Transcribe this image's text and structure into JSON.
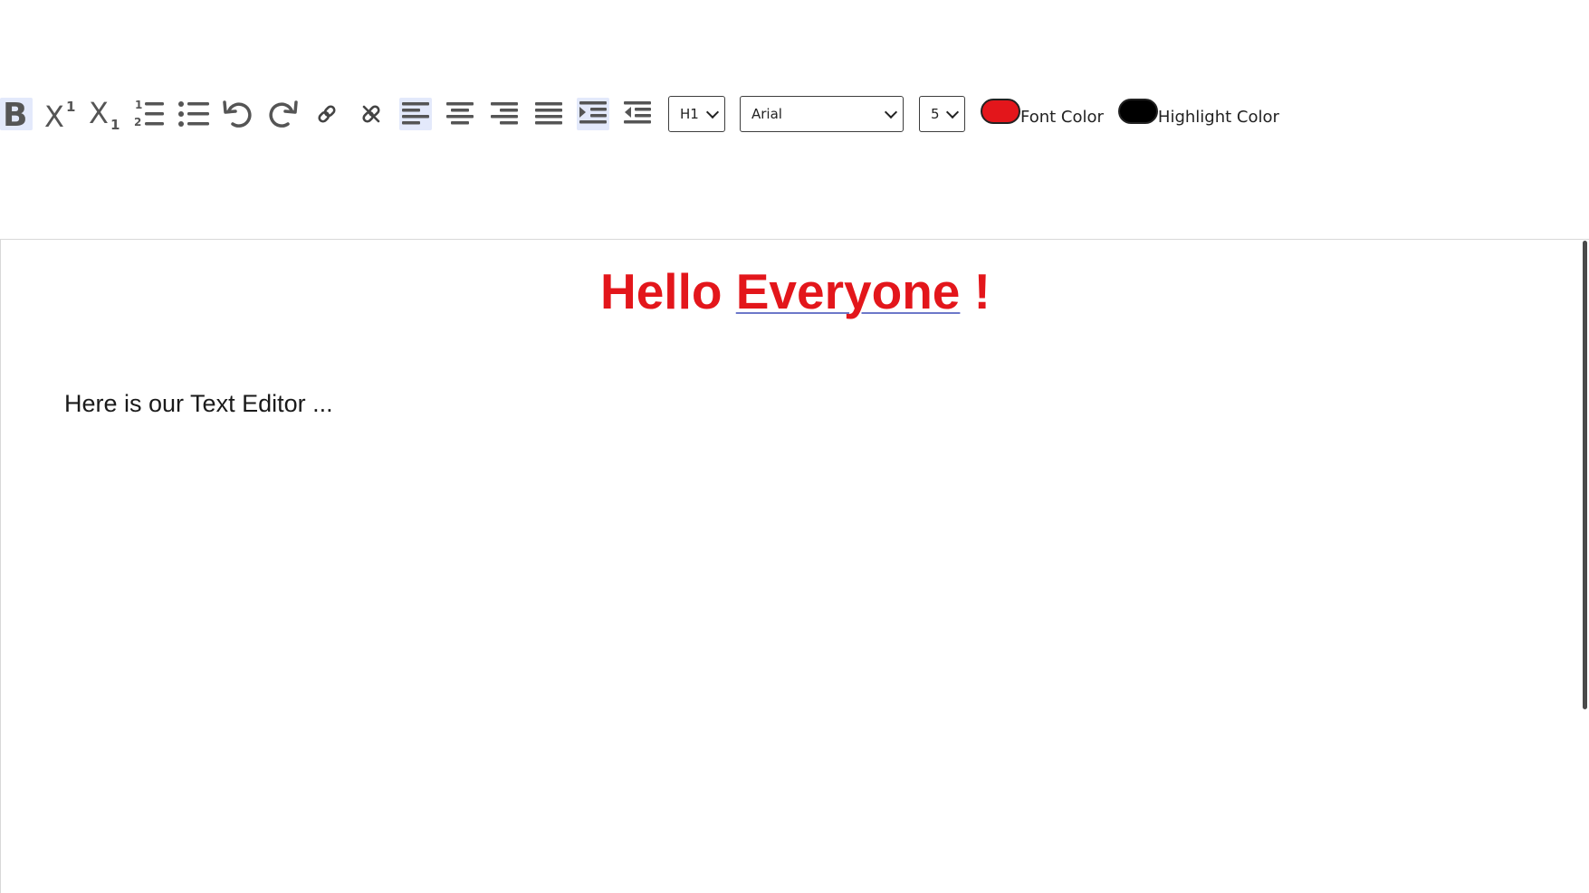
{
  "toolbar": {
    "buttons": [
      {
        "name": "bold-button",
        "icon": "bold-icon"
      },
      {
        "name": "superscript-button",
        "icon": "superscript-icon"
      },
      {
        "name": "subscript-button",
        "icon": "subscript-icon"
      },
      {
        "name": "ordered-list-button",
        "icon": "ordered-list-icon"
      },
      {
        "name": "unordered-list-button",
        "icon": "unordered-list-icon"
      },
      {
        "name": "undo-button",
        "icon": "undo-icon"
      },
      {
        "name": "redo-button",
        "icon": "redo-icon"
      },
      {
        "name": "link-button",
        "icon": "link-icon"
      },
      {
        "name": "unlink-button",
        "icon": "unlink-icon"
      },
      {
        "name": "align-left-button",
        "icon": "align-left-icon"
      },
      {
        "name": "align-center-button",
        "icon": "align-center-icon"
      },
      {
        "name": "align-right-button",
        "icon": "align-right-icon"
      },
      {
        "name": "justify-button",
        "icon": "justify-icon"
      },
      {
        "name": "indent-button",
        "icon": "indent-icon"
      },
      {
        "name": "outdent-button",
        "icon": "outdent-icon"
      }
    ],
    "active_buttons": [
      "bold-button",
      "align-left-button",
      "indent-button"
    ],
    "heading_select": {
      "value": "H1"
    },
    "font_select": {
      "value": "Arial"
    },
    "size_select": {
      "value": "5"
    },
    "font_color": {
      "label": "Font Color",
      "value": "#e3161b"
    },
    "highlight_color": {
      "label": "Highlight Color",
      "value": "#000000"
    }
  },
  "editor": {
    "heading": {
      "word1": "Hello",
      "word2": "Everyone",
      "tail": " !"
    },
    "paragraph": "Here is our Text Editor ..."
  },
  "colors": {
    "icon": "#555555",
    "active_bg": "#e3e9fb",
    "heading_text": "#e3161b"
  }
}
